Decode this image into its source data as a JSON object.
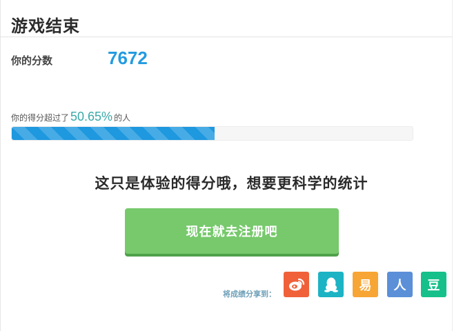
{
  "header": {
    "title": "游戏结束"
  },
  "score": {
    "label": "你的分数",
    "value": "7672"
  },
  "ranking": {
    "prefix": "你的得分超过了",
    "percent_text": "50.65%",
    "suffix": "的人",
    "progress_fraction": 0.5065
  },
  "promo": {
    "text": "这只是体验的得分哦，想要更科学的统计"
  },
  "register_button": {
    "label": "现在就去注册吧"
  },
  "share": {
    "label": "将成绩分享到：",
    "items": [
      {
        "name": "weibo-icon",
        "glyph": "",
        "color": "#f0613a"
      },
      {
        "name": "qq-icon",
        "glyph": "",
        "color": "#1cb3c4"
      },
      {
        "name": "netease-icon",
        "glyph": "易",
        "color": "#f7a534"
      },
      {
        "name": "renren-icon",
        "glyph": "人",
        "color": "#5b8fd8"
      },
      {
        "name": "douban-icon",
        "glyph": "豆",
        "color": "#15c08a"
      }
    ]
  }
}
